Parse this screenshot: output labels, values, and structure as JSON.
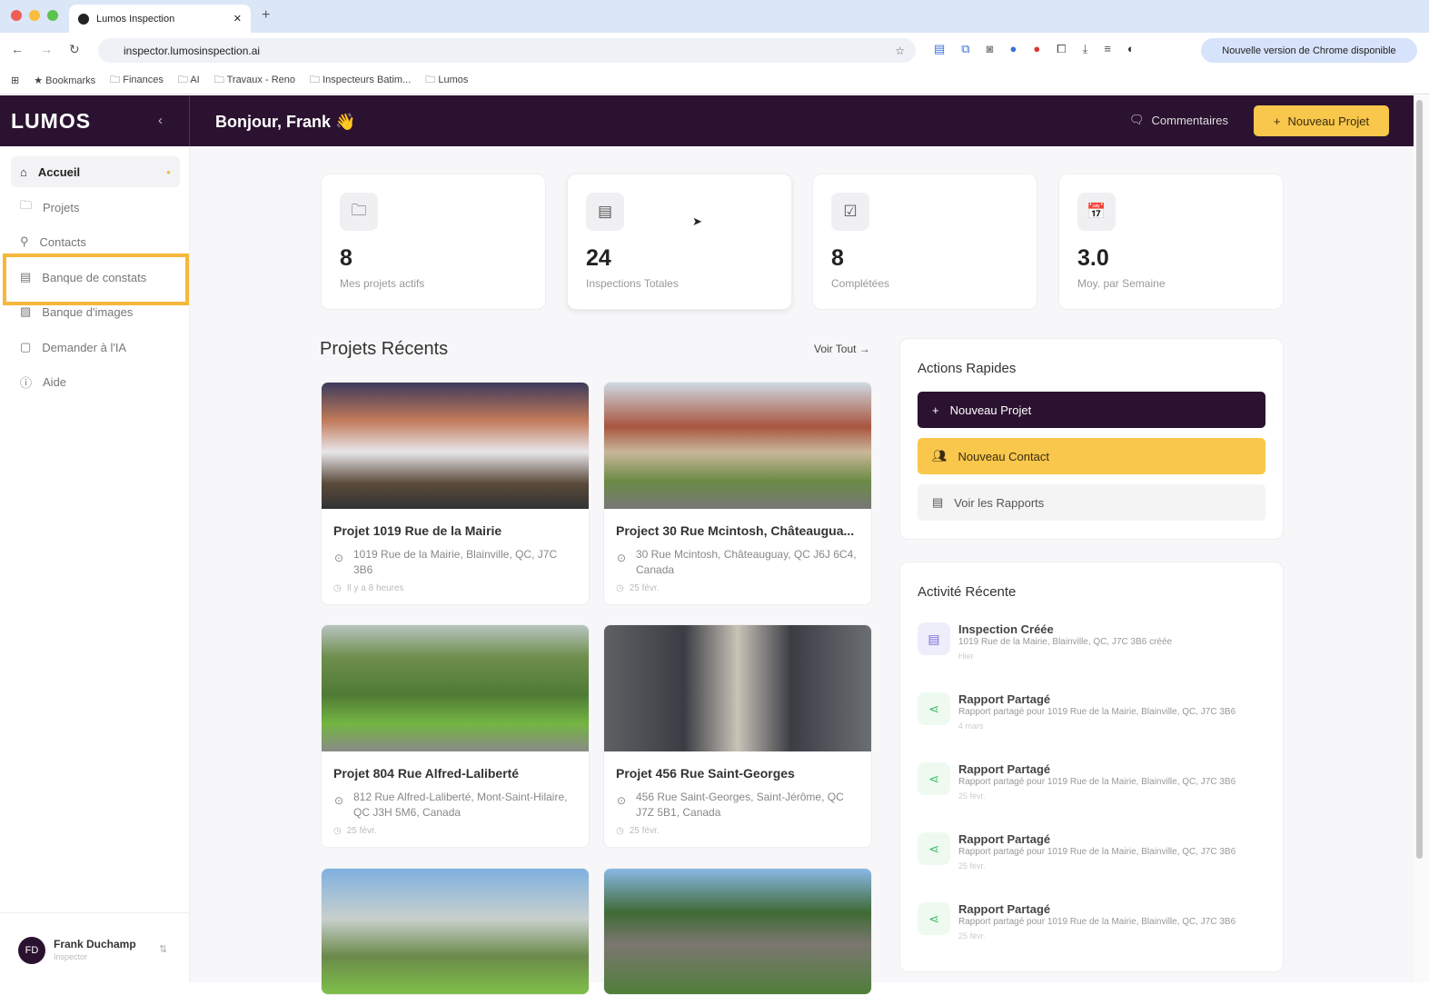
{
  "browser": {
    "tab_title": "Lumos Inspection",
    "url": "inspector.lumosinspection.ai",
    "update_label": "Nouvelle version de Chrome disponible",
    "bookmarks": [
      "Bookmarks",
      "Finances",
      "AI",
      "Travaux - Reno",
      "Inspecteurs Batim...",
      "Lumos"
    ]
  },
  "header": {
    "logo": "LUMOS",
    "greeting": "Bonjour, Frank 👋",
    "comments_label": "Commentaires",
    "new_project_label": "Nouveau Projet"
  },
  "sidebar": {
    "items": [
      {
        "label": "Accueil",
        "icon": "home-icon"
      },
      {
        "label": "Projets",
        "icon": "folder-icon"
      },
      {
        "label": "Contacts",
        "icon": "user-icon"
      },
      {
        "label": "Banque de constats",
        "icon": "document-icon"
      },
      {
        "label": "Banque d'images",
        "icon": "image-icon"
      },
      {
        "label": "Demander à l'IA",
        "icon": "chat-icon"
      },
      {
        "label": "Aide",
        "icon": "help-icon"
      }
    ],
    "user": {
      "initials": "FD",
      "name": "Frank Duchamp",
      "role": "Inspector"
    }
  },
  "stats": [
    {
      "value": "8",
      "label": "Mes projets actifs"
    },
    {
      "value": "24",
      "label": "Inspections Totales"
    },
    {
      "value": "8",
      "label": "Complétées"
    },
    {
      "value": "3.0",
      "label": "Moy. par Semaine"
    }
  ],
  "recent": {
    "title": "Projets Récents",
    "see_all": "Voir Tout →",
    "projects": [
      {
        "title": "Projet 1019 Rue de la Mairie",
        "address": "1019 Rue de la Mairie, Blainville, QC, J7C 3B6",
        "date": "Il y a 8 heures"
      },
      {
        "title": "Project 30 Rue Mcintosh, Châteaugua...",
        "address": "30 Rue Mcintosh, Châteauguay, QC J6J 6C4, Canada",
        "date": "25 févr."
      },
      {
        "title": "Projet 804 Rue Alfred-Laliberté",
        "address": "812 Rue Alfred-Laliberté, Mont-Saint-Hilaire, QC J3H 5M6, Canada",
        "date": "25 févr."
      },
      {
        "title": "Projet 456 Rue Saint-Georges",
        "address": "456 Rue Saint-Georges, Saint-Jérôme, QC J7Z 5B1, Canada",
        "date": "25 févr."
      }
    ]
  },
  "quick": {
    "title": "Actions Rapides",
    "new_project": "Nouveau Projet",
    "new_contact": "Nouveau Contact",
    "view_reports": "Voir les Rapports"
  },
  "activity": {
    "title": "Activité Récente",
    "items": [
      {
        "title": "Inspection Créée",
        "desc": "1019 Rue de la Mairie, Blainville, QC, J7C 3B6 créée",
        "when": "Hier"
      },
      {
        "title": "Rapport Partagé",
        "desc": "Rapport partagé pour 1019 Rue de la Mairie, Blainville, QC, J7C 3B6",
        "when": "4 mars"
      },
      {
        "title": "Rapport Partagé",
        "desc": "Rapport partagé pour 1019 Rue de la Mairie, Blainville, QC, J7C 3B6",
        "when": "25 févr."
      },
      {
        "title": "Rapport Partagé",
        "desc": "Rapport partagé pour 1019 Rue de la Mairie, Blainville, QC, J7C 3B6",
        "when": "25 févr."
      },
      {
        "title": "Rapport Partagé",
        "desc": "Rapport partagé pour 1019 Rue de la Mairie, Blainville, QC, J7C 3B6",
        "when": "25 févr."
      }
    ]
  },
  "colors": {
    "brand_dark": "#2b1230",
    "accent": "#f8c74b",
    "highlight": "#f6b73c"
  }
}
